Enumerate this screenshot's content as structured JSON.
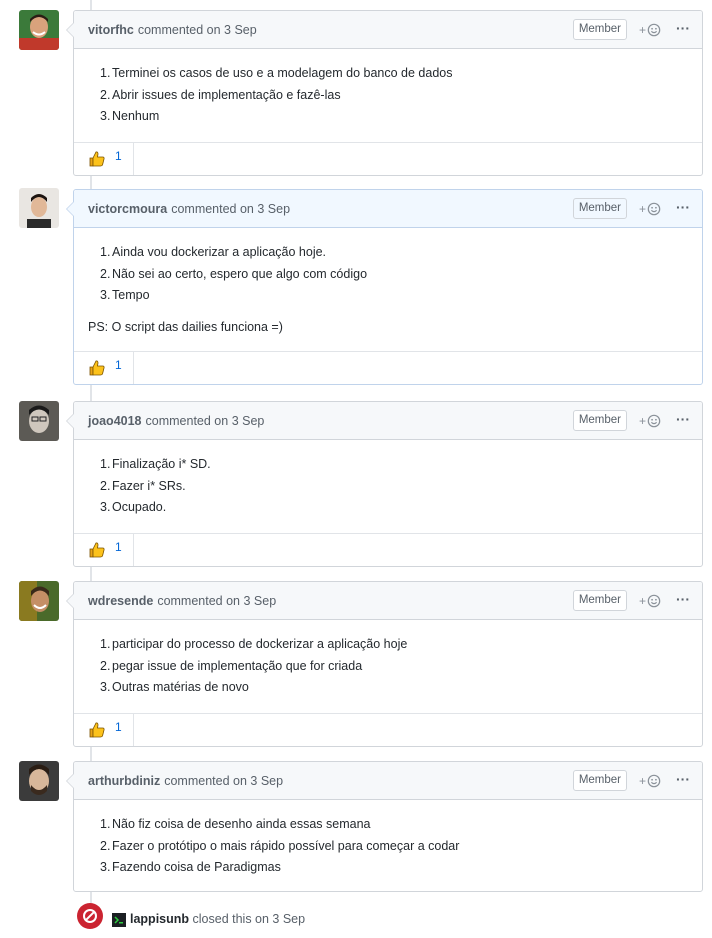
{
  "comments": [
    {
      "author": "vitorfhc",
      "action": "commented on",
      "date": "3 Sep",
      "badge": "Member",
      "items": [
        "Terminei os casos de uso e a modelagem do banco de dados",
        "Abrir issues de implementação e fazê-las",
        "Nenhum"
      ],
      "postscript": "",
      "reaction_count": "1"
    },
    {
      "author": "victorcmoura",
      "action": "commented on",
      "date": "3 Sep",
      "badge": "Member",
      "items": [
        "Ainda vou dockerizar a aplicação hoje.",
        "Não sei ao certo, espero que algo com código",
        "Tempo"
      ],
      "postscript": "PS: O script das dailies funciona =)",
      "reaction_count": "1"
    },
    {
      "author": "joao4018",
      "action": "commented on",
      "date": "3 Sep",
      "badge": "Member",
      "items": [
        "Finalização i* SD.",
        "Fazer i* SRs.",
        "Ocupado."
      ],
      "postscript": "",
      "reaction_count": "1"
    },
    {
      "author": "wdresende",
      "action": "commented on",
      "date": "3 Sep",
      "badge": "Member",
      "items": [
        "participar do processo de dockerizar a aplicação hoje",
        "pegar issue de implementação que for criada",
        "Outras matérias de novo"
      ],
      "postscript": "",
      "reaction_count": "1"
    },
    {
      "author": "arthurbdiniz",
      "action": "commented on",
      "date": "3 Sep",
      "badge": "Member",
      "items": [
        "Não fiz coisa de desenho ainda essas semana",
        "Fazer o protótipo o mais rápido possível para começar a codar",
        "Fazendo coisa de Paradigmas"
      ],
      "postscript": "",
      "reaction_count": ""
    }
  ],
  "numbers": [
    "1.",
    "2.",
    "3."
  ],
  "closed_event": {
    "actor": "lappisunb",
    "text": "closed this on 3 Sep"
  },
  "icons": {
    "reaction": "thumbs-up-icon",
    "add_reaction": "smiley-icon",
    "more": "kebab-horizontal-icon",
    "closed": "circle-slash-icon"
  },
  "colors": {
    "closed_badge": "#cb2431",
    "link": "#0366d6",
    "active_header": "#f1f8ff"
  }
}
